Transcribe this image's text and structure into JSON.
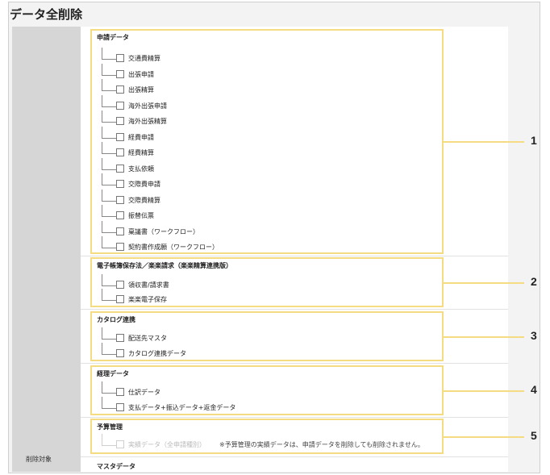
{
  "page": {
    "title": "データ全削除"
  },
  "sidebar": {
    "delete_target_label": "削除対象"
  },
  "sections": [
    {
      "number": "1",
      "title": "申請データ",
      "items": [
        "交通費精算",
        "出張申請",
        "出張精算",
        "海外出張申請",
        "海外出張精算",
        "経費申請",
        "経費精算",
        "支払依頼",
        "交際費申請",
        "交際費精算",
        "振替伝票",
        "稟議書（ワークフロー）",
        "契約書作成願（ワークフロー）"
      ]
    },
    {
      "number": "2",
      "title": "電子帳簿保存法／楽楽請求（楽楽精算連携版）",
      "items": [
        "領収書/請求書",
        "楽楽電子保存"
      ]
    },
    {
      "number": "3",
      "title": "カタログ連携",
      "items": [
        "配送先マスタ",
        "カタログ連携データ"
      ]
    },
    {
      "number": "4",
      "title": "経理データ",
      "items": [
        "仕訳データ",
        "支払データ+振込データ+返金データ"
      ]
    },
    {
      "number": "5",
      "title": "予算管理",
      "items": [
        "実績データ（全申請種別）"
      ],
      "note": "※予算管理の実績データは、申請データを削除しても削除されません。"
    }
  ],
  "master": {
    "title": "マスタデータ"
  },
  "colors": {
    "highlight": "#f5dc82",
    "label_bg": "#d6d6d6"
  }
}
